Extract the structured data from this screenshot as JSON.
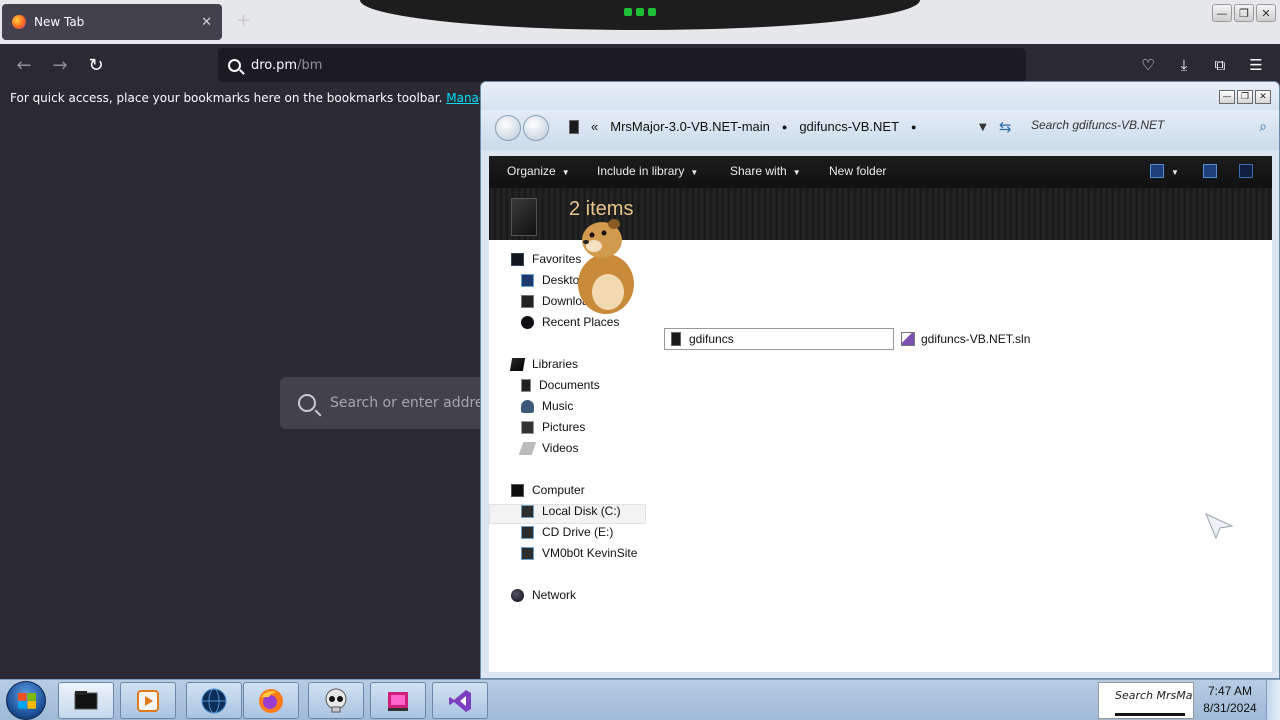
{
  "browser": {
    "tab_title": "New Tab",
    "tab_close": "✕",
    "new_tab": "+",
    "url_host": "dro.pm",
    "url_path": "/bm",
    "bookmarks_text": "For quick access, place your bookmarks here on the bookmarks toolbar.",
    "bookmarks_link": "Manage bookmarks",
    "newtab_search_placeholder": "Search or enter address"
  },
  "window_controls": {
    "minimize": "—",
    "restore": "❐",
    "close": "✕"
  },
  "explorer": {
    "breadcrumb": [
      "MrsMajor-3.0-VB.NET-main",
      "gdifuncs-VB.NET"
    ],
    "breadcrumb_overflow": "«",
    "search_placeholder": "Search gdifuncs-VB.NET",
    "commands": [
      "Organize",
      "Include in library",
      "Share with",
      "New folder"
    ],
    "item_count": "2 items",
    "nav": {
      "favorites": {
        "label": "Favorites",
        "items": [
          "Desktop",
          "Downloads",
          "Recent Places"
        ]
      },
      "libraries": {
        "label": "Libraries",
        "items": [
          "Documents",
          "Music",
          "Pictures",
          "Videos"
        ]
      },
      "computer": {
        "label": "Computer",
        "items": [
          "Local Disk (C:)",
          "CD Drive (E:)",
          "VM0b0t KevinSite"
        ]
      },
      "network": {
        "label": "Network"
      }
    },
    "files": [
      "gdifuncs",
      "gdifuncs-VB.NET.sln"
    ]
  },
  "taskbar": {
    "tray_search": "Search MrsMa",
    "time": "7:47 AM",
    "date": "8/31/2024",
    "apps": [
      "file-manager-icon",
      "media-player-icon",
      "globe-icon",
      "firefox-icon",
      "skull-icon",
      "media-encoder-icon",
      "visual-studio-icon"
    ]
  },
  "colors": {
    "accent_link": "#00ddff",
    "banner_text": "#e8c48a",
    "firefox_bg": "#2b2a33"
  }
}
